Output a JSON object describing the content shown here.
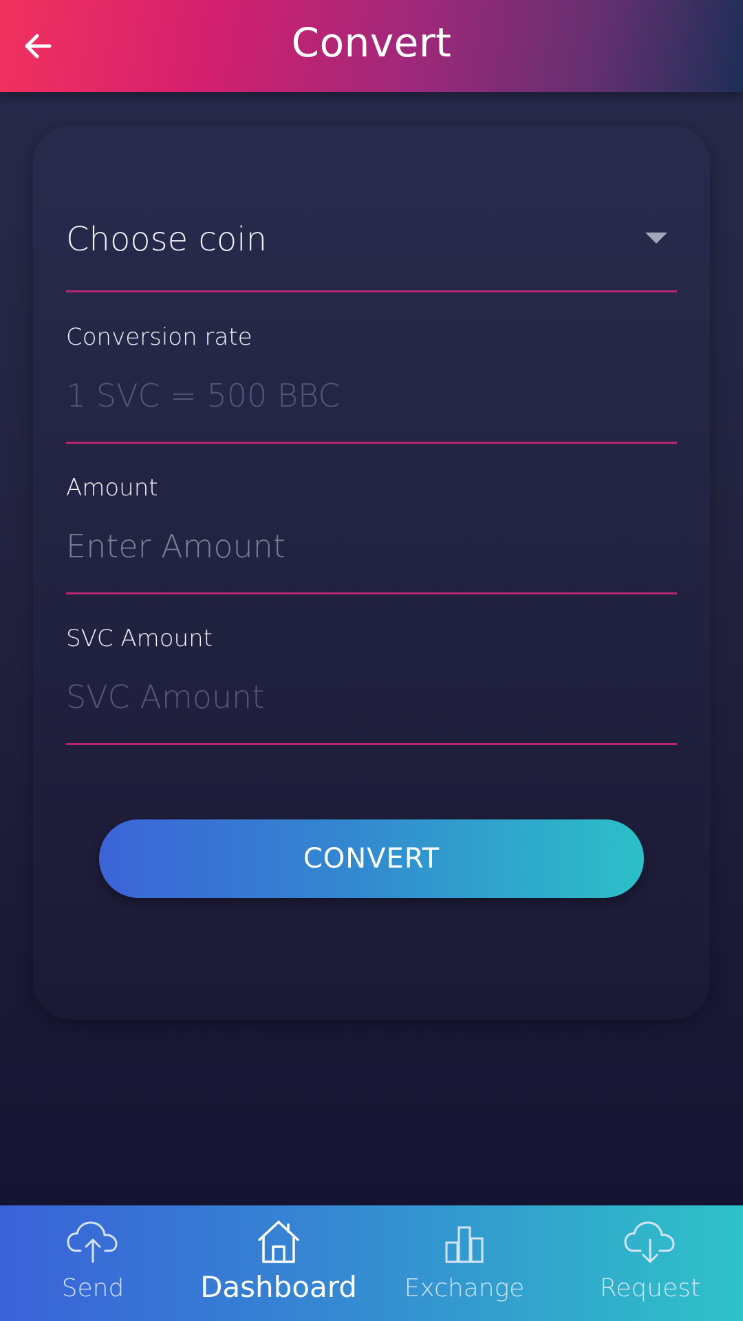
{
  "header": {
    "title": "Convert",
    "back_icon": "arrow-left-icon"
  },
  "form": {
    "choose_coin": {
      "value": "Choose coin",
      "icon": "dropdown-caret-icon"
    },
    "conversion_rate": {
      "label": "Conversion rate",
      "placeholder": "1 SVC = 500 BBC"
    },
    "amount": {
      "label": "Amount",
      "placeholder": "Enter Amount"
    },
    "svc_amount": {
      "label": "SVC Amount",
      "placeholder": "SVC Amount"
    },
    "submit_label": "CONVERT"
  },
  "bottom_nav": {
    "active": "Dashboard",
    "items": [
      {
        "label": "Send",
        "icon": "cloud-upload-icon"
      },
      {
        "label": "Dashboard",
        "icon": "home-icon"
      },
      {
        "label": "Exchange",
        "icon": "bar-chart-icon"
      },
      {
        "label": "Request",
        "icon": "cloud-download-icon"
      }
    ]
  },
  "colors": {
    "header_gradient": [
      "#f2325e",
      "#a0287a",
      "#1d2f56"
    ],
    "accent_underline": "#b8276f",
    "button_gradient": [
      "#3c64d8",
      "#2cc0c8"
    ],
    "background": "#22223f"
  }
}
